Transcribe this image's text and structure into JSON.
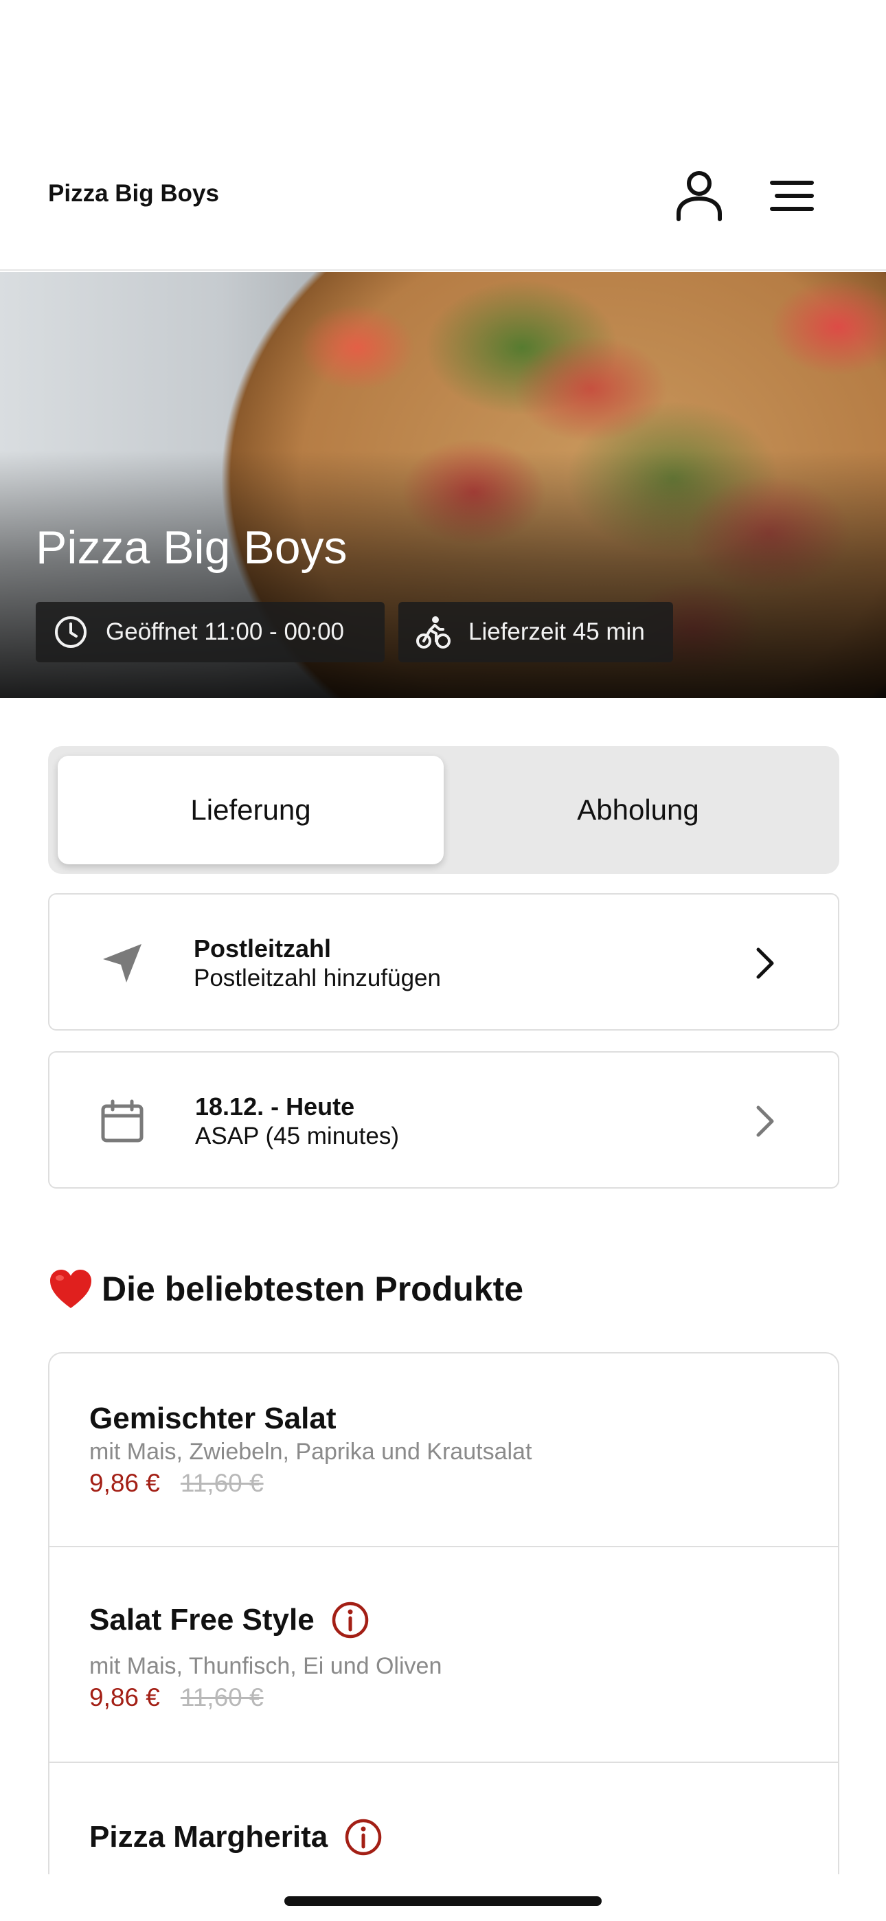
{
  "header": {
    "brand": "Pizza Big Boys"
  },
  "icons": {
    "account": "user-icon",
    "menu": "hamburger-menu-icon"
  },
  "hero": {
    "title": "Pizza Big Boys",
    "opening": "Geöffnet 11:00 - 00:00",
    "delivery_time": "Lieferzeit 45 min"
  },
  "mode": {
    "delivery": "Lieferung",
    "pickup": "Abholung",
    "selected": "Lieferung"
  },
  "postal": {
    "title": "Postleitzahl",
    "subtitle": "Postleitzahl hinzufügen"
  },
  "schedule": {
    "title": "18.12. - Heute",
    "subtitle": "ASAP (45 minutes)"
  },
  "popular": {
    "title": "Die beliebtesten Produkte",
    "items": [
      {
        "name": "Gemischter Salat",
        "description": "mit Mais, Zwiebeln, Paprika und Krautsalat",
        "price": "9,86 €",
        "old_price": "11,60 €"
      },
      {
        "name": "Salat Free Style",
        "description": "mit Mais, Thunfisch, Ei und Oliven",
        "price": "9,86 €",
        "old_price": "11,60 €"
      },
      {
        "name": "Pizza Margherita"
      }
    ]
  },
  "colors": {
    "accent": "#a31f15",
    "muted": "#8a8a8a",
    "toggle_bg": "#e8e8e8"
  }
}
